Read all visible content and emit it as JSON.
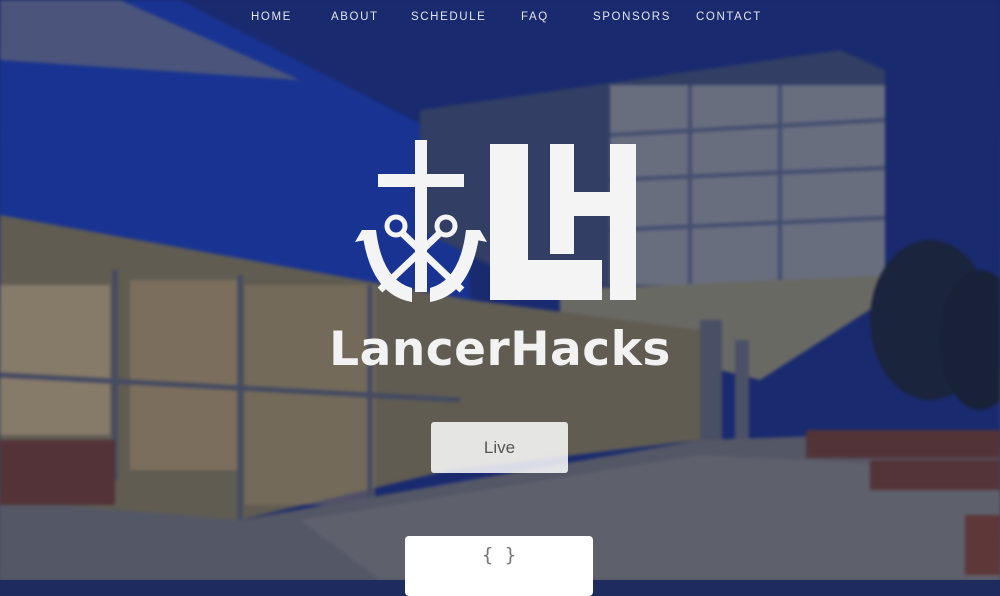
{
  "nav": {
    "items": [
      {
        "label": "HOME"
      },
      {
        "label": "ABOUT"
      },
      {
        "label": "SCHEDULE"
      },
      {
        "label": "FAQ"
      },
      {
        "label": "SPONSORS"
      },
      {
        "label": "CONTACT"
      }
    ]
  },
  "hero": {
    "logo_letters": "LH",
    "brand_name": "LancerHacks",
    "live_button_label": "Live",
    "code_card_text": "{ }"
  },
  "colors": {
    "sky": "#16296e",
    "logo": "#f4f4f4",
    "button_bg": "#ffffff",
    "button_text": "#555555"
  }
}
